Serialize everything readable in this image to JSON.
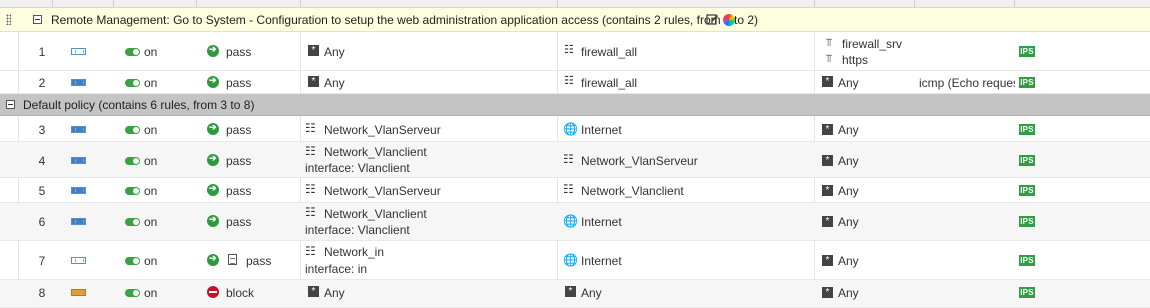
{
  "section_remote": {
    "title": "Remote Management: Go to System - Configuration to setup the web administration application access (contains 2 rules, from 1 to 2)"
  },
  "section_default": {
    "title": "Default policy (contains 6 rules, from 3 to 8)"
  },
  "rules": [
    {
      "num": "1",
      "status": "on",
      "action": "pass",
      "source": "Any",
      "destination": "firewall_all",
      "dest_port": [
        "firewall_srv",
        "https"
      ],
      "inspection": "IPS"
    },
    {
      "num": "2",
      "status": "on",
      "action": "pass",
      "source": "Any",
      "destination": "firewall_all",
      "dest_port": "Any",
      "protocol": "icmp  (Echo reques",
      "inspection": "IPS"
    },
    {
      "num": "3",
      "status": "on",
      "action": "pass",
      "source": "Network_VlanServeur",
      "destination": "Internet",
      "dest_port": "Any",
      "inspection": "IPS"
    },
    {
      "num": "4",
      "status": "on",
      "action": "pass",
      "source": "Network_Vlanclient",
      "source_iface": "interface: Vlanclient",
      "destination": "Network_VlanServeur",
      "dest_port": "Any",
      "inspection": "IPS"
    },
    {
      "num": "5",
      "status": "on",
      "action": "pass",
      "source": "Network_VlanServeur",
      "destination": "Network_Vlanclient",
      "dest_port": "Any",
      "inspection": "IPS"
    },
    {
      "num": "6",
      "status": "on",
      "action": "pass",
      "source": "Network_Vlanclient",
      "source_iface": "interface: Vlanclient",
      "destination": "Internet",
      "dest_port": "Any",
      "inspection": "IPS"
    },
    {
      "num": "7",
      "status": "on",
      "action": "pass",
      "source": "Network_in",
      "source_iface": "interface: in",
      "destination": "Internet",
      "dest_port": "Any",
      "inspection": "IPS"
    },
    {
      "num": "8",
      "status": "on",
      "action": "block",
      "source": "Any",
      "destination": "Any",
      "dest_port": "Any",
      "inspection": "IPS"
    }
  ],
  "icons": {
    "pass": "pass-icon",
    "block": "block-icon",
    "any": "any-object-icon",
    "network": "network-icon",
    "internet": "globe-icon",
    "service": "service-icon",
    "log": "log-icon"
  },
  "colors": {
    "pass": "#2e9a3f",
    "block": "#c8102e",
    "toggle_on": "#39a244",
    "ips_badge": "#2ea043",
    "section_remote_bg": "#fdfddf",
    "section_default_bg": "#c4c4c4"
  }
}
